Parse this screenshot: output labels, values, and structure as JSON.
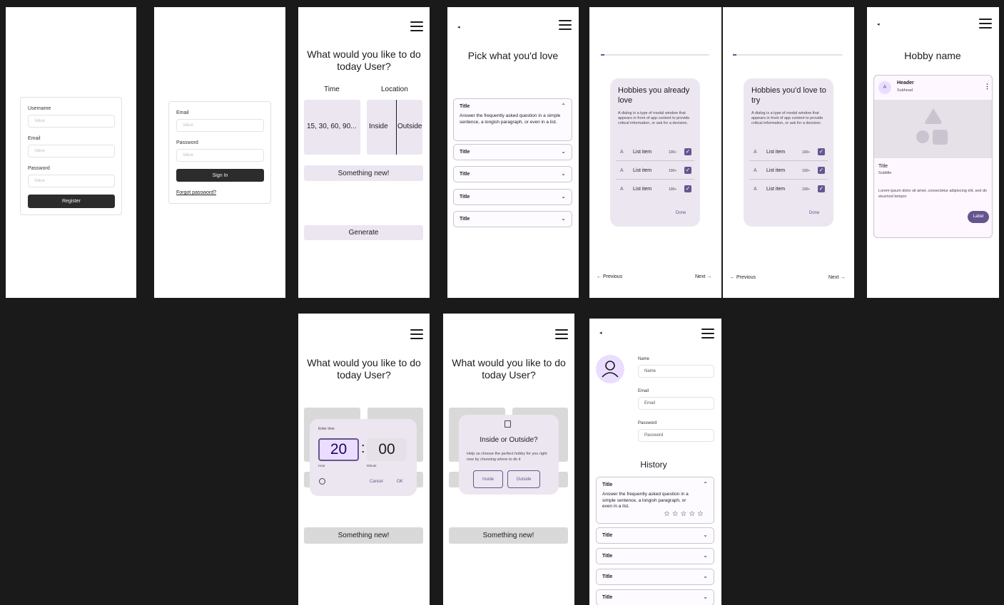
{
  "register": {
    "username_label": "Username",
    "username_placeholder": "Value",
    "email_label": "Email",
    "email_placeholder": "Value",
    "password_label": "Password",
    "password_placeholder": "Value",
    "register_button": "Register"
  },
  "signin": {
    "email_label": "Email",
    "email_placeholder": "Value",
    "password_label": "Password",
    "password_placeholder": "Value",
    "signin_button": "Sign In",
    "forgot_link": "Forgot password?"
  },
  "home": {
    "title": "What would you like to do today User?",
    "time_label": "Time",
    "location_label": "Location",
    "time_value": "15, 30, 60, 90...",
    "inside_label": "Inside",
    "outside_label": "Outside",
    "something_new": "Something new!",
    "generate": "Generate"
  },
  "pick": {
    "title": "Pick what you'd love",
    "accordions": [
      {
        "title": "Title",
        "body": "Answer the frequently asked question in a simple sentence, a longish paragraph, or even in a list."
      },
      {
        "title": "Title"
      },
      {
        "title": "Title"
      },
      {
        "title": "Title"
      },
      {
        "title": "Title"
      }
    ]
  },
  "already_love": {
    "title": "Hobbies you already love",
    "supporting": "A dialog is a type of modal window that appears in front of app content to provide critical information, or ask for a decision.",
    "items": [
      {
        "avatar": "A",
        "label": "List item",
        "meta": "100+"
      },
      {
        "avatar": "A",
        "label": "List item",
        "meta": "100+"
      },
      {
        "avatar": "A",
        "label": "List item",
        "meta": "100+"
      }
    ],
    "done": "Done",
    "previous": "← Previous",
    "next": "Next →"
  },
  "love_to_try": {
    "title": "Hobbies you'd love to try",
    "supporting": "A dialog is a type of modal window that appears in front of app content to provide critical information, or ask for a decision.",
    "items": [
      {
        "avatar": "A",
        "label": "List item",
        "meta": "100+"
      },
      {
        "avatar": "A",
        "label": "List item",
        "meta": "100+"
      },
      {
        "avatar": "A",
        "label": "List item",
        "meta": "100+"
      }
    ],
    "done": "Done",
    "previous": "← Previous",
    "next": "Next →"
  },
  "hobby": {
    "title": "Hobby name",
    "header": "Header",
    "subhead": "Subhead",
    "avatar": "A",
    "card_title": "Title",
    "card_subtitle": "Subtitle",
    "body": "Lorem ipsum dolor sit amet, consectetur adipiscing elit, sed do eiusmod tempor",
    "label_button": "Label"
  },
  "time_picker": {
    "title": "What would you like to do today User?",
    "enter_time": "Enter time",
    "hour": "20",
    "minute": "00",
    "hour_label": "Hour",
    "minute_label": "Minute",
    "cancel": "Cancel",
    "ok": "OK",
    "something_new": "Something new!"
  },
  "location_dialog": {
    "title": "What would you like to do today User?",
    "dialog_title": "Inside or Outside?",
    "dialog_body": "Help us choose the perfect hobby for you right now by choosing where to do it",
    "inside": "Inside",
    "outside": "Outside",
    "something_new": "Something new!"
  },
  "profile": {
    "name_label": "Name",
    "name_value": "Name",
    "email_label": "Email",
    "email_value": "Email",
    "password_label": "Password",
    "password_value": "Password",
    "history_title": "History",
    "accordions": [
      {
        "title": "Title",
        "body": "Answer the frequently asked question in a simple sentence, a longish paragraph, or even in a list.",
        "stars": "☆ ☆ ☆ ☆ ☆"
      },
      {
        "title": "Title"
      },
      {
        "title": "Title"
      },
      {
        "title": "Title"
      },
      {
        "title": "Title"
      }
    ]
  },
  "icons": {
    "menu": "menu-icon",
    "back": "back-icon",
    "chevron_up": "chevron-up-icon",
    "chevron_down": "chevron-down-icon",
    "check": "check-icon",
    "more": "more-vert-icon",
    "clock": "clock-icon",
    "person": "person-icon"
  },
  "colors": {
    "background": "#1a1a1a",
    "surface": "#ffffff",
    "primary": "#65558f",
    "container": "#ece6f0",
    "dark_button": "#2c2c2c"
  }
}
